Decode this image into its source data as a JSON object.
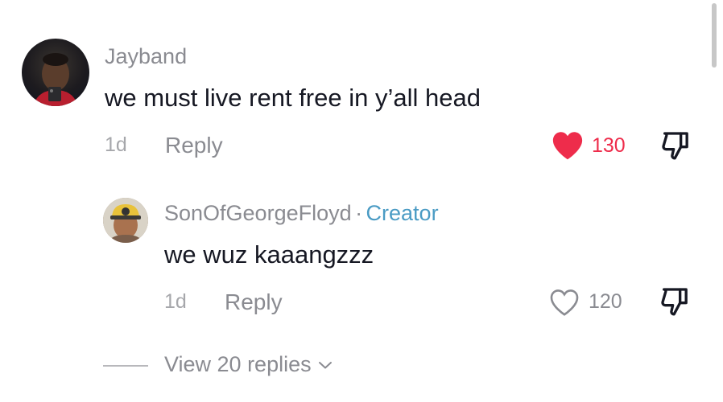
{
  "thread": {
    "top_comment": {
      "username": "Jayband",
      "text": "we must live rent free in y’all head",
      "date": "1d",
      "reply_label": "Reply",
      "like_count": "130",
      "liked": true
    },
    "reply_comment": {
      "username": "SonOfGeorgeFloyd",
      "separator": "·",
      "badge": "Creator",
      "text": "we wuz kaaangzzz",
      "date": "1d",
      "reply_label": "Reply",
      "like_count": "120",
      "liked": false
    },
    "view_replies_label": "View 20 replies"
  },
  "colors": {
    "liked_heart": "#ee2c4b",
    "muted_text": "#8a8b91",
    "creator_badge": "#4a9bc4"
  },
  "icons": {
    "heart": "heart-icon",
    "dislike": "thumbs-down-icon",
    "chevron": "chevron-down-icon"
  }
}
